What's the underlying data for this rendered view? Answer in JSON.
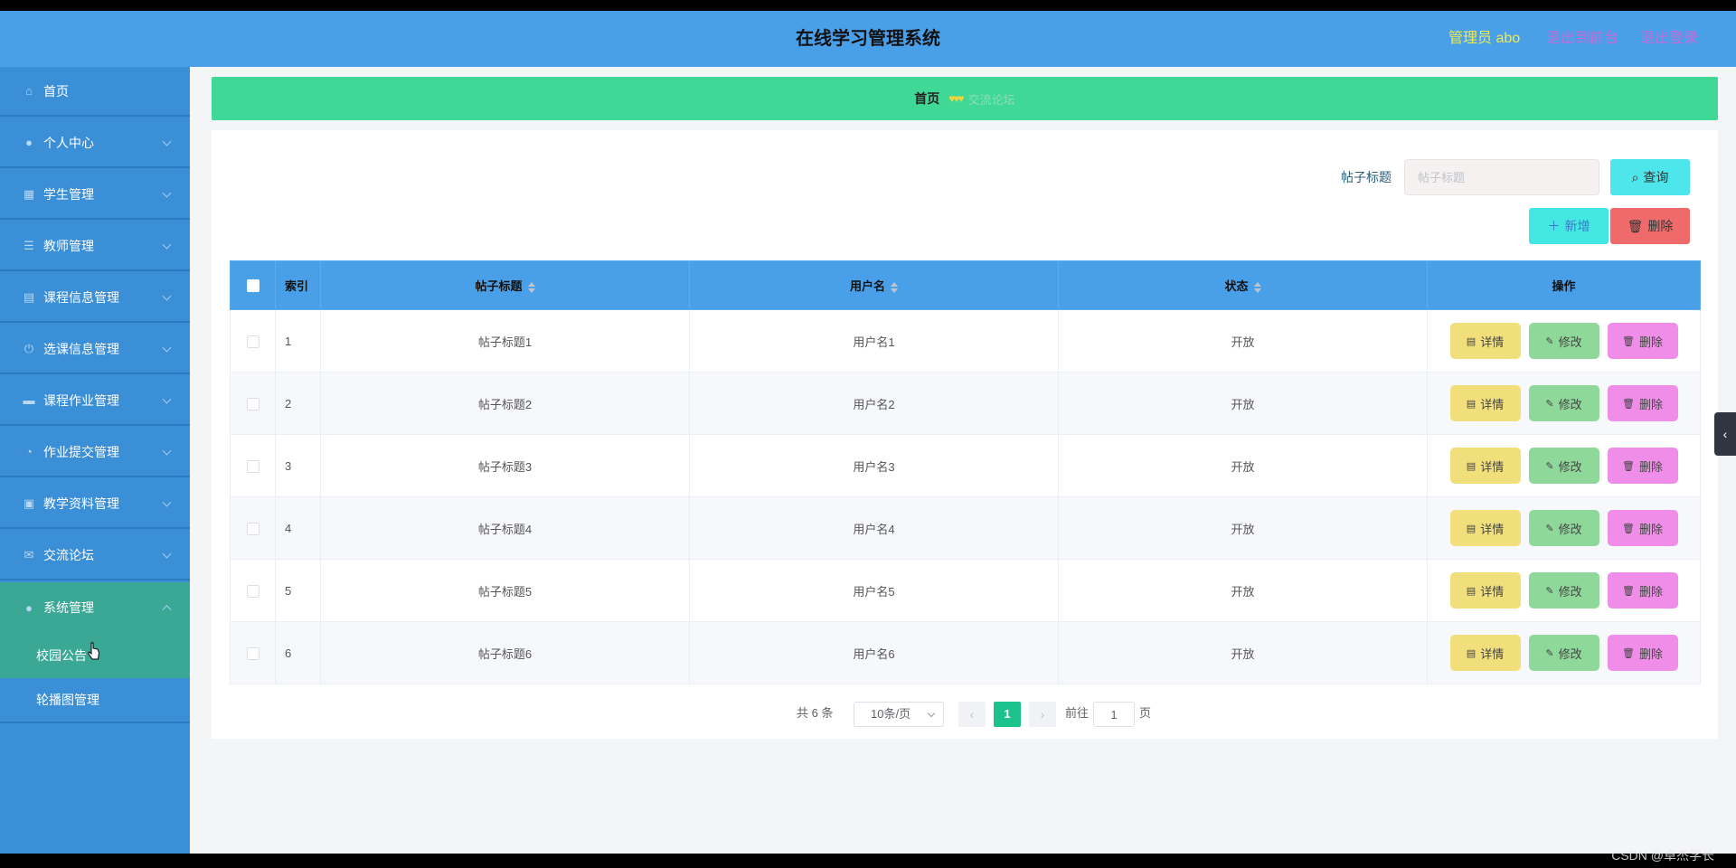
{
  "header": {
    "title": "在线学习管理系统",
    "admin_label": "管理员 abo",
    "to_front_label": "退出到前台",
    "logout_label": "退出登录"
  },
  "sidebar": {
    "items": [
      {
        "label": "首页",
        "icon": "home-icon"
      },
      {
        "label": "个人中心",
        "icon": "user-icon"
      },
      {
        "label": "学生管理",
        "icon": "grid-icon"
      },
      {
        "label": "教师管理",
        "icon": "menu-lines-icon"
      },
      {
        "label": "课程信息管理",
        "icon": "course-icon"
      },
      {
        "label": "选课信息管理",
        "icon": "power-icon"
      },
      {
        "label": "课程作业管理",
        "icon": "homework-icon"
      },
      {
        "label": "作业提交管理",
        "icon": "gauge-icon"
      },
      {
        "label": "教学资料管理",
        "icon": "clipboard-icon"
      },
      {
        "label": "交流论坛",
        "icon": "mail-icon"
      },
      {
        "label": "系统管理",
        "icon": "user-icon"
      }
    ],
    "sub_items": [
      {
        "label": "校园公告"
      },
      {
        "label": "轮播图管理"
      }
    ]
  },
  "breadcrumb": {
    "home": "首页",
    "current": "交流论坛"
  },
  "search": {
    "label": "帖子标题",
    "placeholder": "帖子标题",
    "query_label": "查询"
  },
  "actions": {
    "add_label": "新增",
    "delete_label": "删除"
  },
  "table": {
    "headers": [
      "索引",
      "帖子标题",
      "用户名",
      "状态",
      "操作"
    ],
    "rows": [
      {
        "index": "1",
        "title": "帖子标题1",
        "user": "用户名1",
        "status": "开放"
      },
      {
        "index": "2",
        "title": "帖子标题2",
        "user": "用户名2",
        "status": "开放"
      },
      {
        "index": "3",
        "title": "帖子标题3",
        "user": "用户名3",
        "status": "开放"
      },
      {
        "index": "4",
        "title": "帖子标题4",
        "user": "用户名4",
        "status": "开放"
      },
      {
        "index": "5",
        "title": "帖子标题5",
        "user": "用户名5",
        "status": "开放"
      },
      {
        "index": "6",
        "title": "帖子标题6",
        "user": "用户名6",
        "status": "开放"
      }
    ],
    "row_actions": {
      "detail": "详情",
      "edit": "修改",
      "delete": "删除"
    }
  },
  "pagination": {
    "total_text": "共 6 条",
    "page_size": "10条/页",
    "current_page": "1",
    "goto_label": "前往",
    "goto_value": "1",
    "page_suffix": "页"
  },
  "watermark": "CSDN @卓杰学长",
  "colors": {
    "header": "#4aa0e8",
    "sidebar": "#3b8fd6",
    "sidebar_active": "#3aa895",
    "breadcrumb": "#3fd897",
    "detail_button": "#f0df7b",
    "edit_button": "#8ed99a",
    "delete_button": "#f08de8"
  }
}
